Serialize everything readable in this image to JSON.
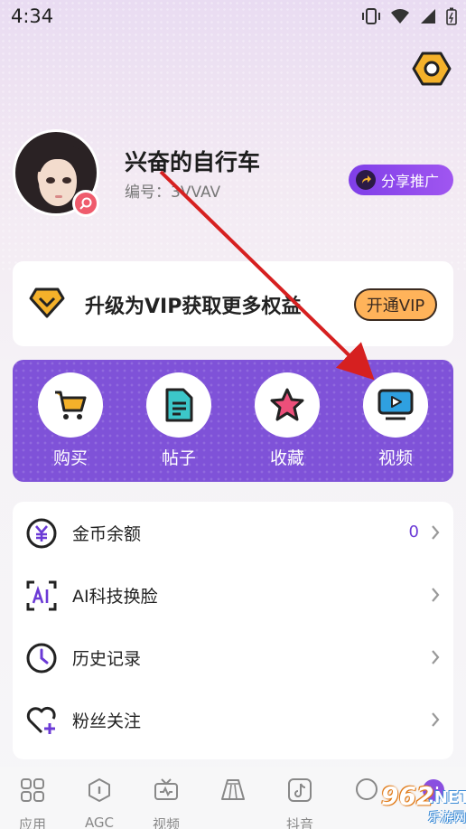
{
  "status_bar": {
    "time": "4:34",
    "icons": [
      "vibrate-icon",
      "wifi-icon",
      "signal-icon",
      "battery-icon"
    ]
  },
  "profile": {
    "username": "兴奋的自行车",
    "user_id": "编号：3VVAV",
    "share_label": "分享推广"
  },
  "vip": {
    "text": "升级为VIP获取更多权益",
    "button_label": "开通VIP"
  },
  "quick_actions": [
    {
      "label": "购买",
      "icon": "cart-icon"
    },
    {
      "label": "帖子",
      "icon": "document-icon"
    },
    {
      "label": "收藏",
      "icon": "star-icon"
    },
    {
      "label": "视频",
      "icon": "video-icon"
    }
  ],
  "menu": [
    {
      "label": "金币余额",
      "value": "0",
      "icon": "coin-icon"
    },
    {
      "label": "AI科技换脸",
      "value": "",
      "icon": "ai-icon"
    },
    {
      "label": "历史记录",
      "value": "",
      "icon": "clock-icon"
    },
    {
      "label": "粉丝关注",
      "value": "",
      "icon": "heart-plus-icon"
    }
  ],
  "bottom_nav": [
    {
      "label": "应用",
      "icon": "apps-icon"
    },
    {
      "label": "AGC",
      "icon": "agc-icon"
    },
    {
      "label": "视频",
      "icon": "tv-icon"
    },
    {
      "label": "",
      "icon": "skirt-icon"
    },
    {
      "label": "抖音",
      "icon": "tiktok-icon"
    },
    {
      "label": "",
      "icon": "chat-icon"
    },
    {
      "label": "",
      "icon": "profile-icon"
    }
  ],
  "watermark": {
    "number": "962",
    "domain": ".NET",
    "name": "乐游网"
  },
  "colors": {
    "accent": "#7f52d8",
    "vip_button": "#ffb35a",
    "annotation_arrow": "#d62020"
  }
}
